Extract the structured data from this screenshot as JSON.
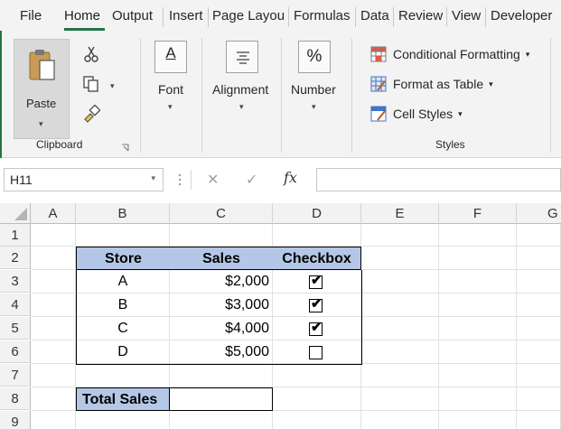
{
  "tabs": [
    {
      "label": "File",
      "active": false
    },
    {
      "label": "Home",
      "active": true
    },
    {
      "label": "Output",
      "active": false
    },
    {
      "label": "Insert",
      "active": false
    },
    {
      "label": "Page Layou",
      "active": false
    },
    {
      "label": "Formulas",
      "active": false
    },
    {
      "label": "Data",
      "active": false
    },
    {
      "label": "Review",
      "active": false
    },
    {
      "label": "View",
      "active": false
    },
    {
      "label": "Developer",
      "active": false
    }
  ],
  "ribbon": {
    "clipboard": {
      "paste_label": "Paste",
      "group_label": "Clipboard"
    },
    "font_label": "Font",
    "font_icon_glyph": "A",
    "alignment_label": "Alignment",
    "number_label": "Number",
    "number_icon_glyph": "%",
    "styles": {
      "conditional_formatting": "Conditional Formatting",
      "format_as_table": "Format as Table",
      "cell_styles": "Cell Styles",
      "group_label": "Styles"
    },
    "dropdown_caret": "▾"
  },
  "formula_bar": {
    "name_box": "H11",
    "cancel_glyph": "✕",
    "enter_glyph": "✓",
    "fx_glyph": "fx",
    "formula": ""
  },
  "grid": {
    "columns": [
      "A",
      "B",
      "C",
      "D",
      "E",
      "F",
      "G"
    ],
    "rows": [
      "1",
      "2",
      "3",
      "4",
      "5",
      "6",
      "7",
      "8",
      "9"
    ]
  },
  "table": {
    "headers": [
      "Store",
      "Sales",
      "Checkbox"
    ],
    "rows": [
      {
        "store": "A",
        "sales": "$2,000",
        "checked": true
      },
      {
        "store": "B",
        "sales": "$3,000",
        "checked": true
      },
      {
        "store": "C",
        "sales": "$4,000",
        "checked": true
      },
      {
        "store": "D",
        "sales": "$5,000",
        "checked": false
      }
    ],
    "total_label": "Total Sales",
    "total_value": ""
  },
  "colors": {
    "accent_green": "#217346",
    "header_fill": "#b4c7e7"
  }
}
